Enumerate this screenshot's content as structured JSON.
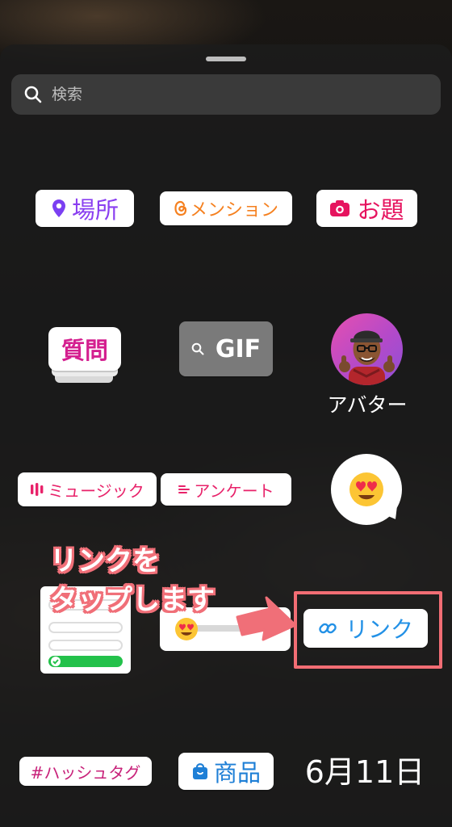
{
  "search": {
    "placeholder": "検索"
  },
  "stickers": {
    "place": "場所",
    "mention": "メンション",
    "question_prompt": "お題",
    "questions": "質問",
    "gif": "GIF",
    "avatar": "アバター",
    "music": "ミュージック",
    "poll": "アンケート",
    "link": "リンク",
    "hashtag": "#ハッシュタグ",
    "shopping": "商品",
    "date": "6月11日"
  },
  "annotation": {
    "line1": "リンクを",
    "line2": "タップします"
  },
  "colors": {
    "highlight": "#f26d74",
    "link_blue": "#2391e6",
    "mention_orange": "#f5801f",
    "place_purple": "#8a3ff0",
    "prompt_pink": "#e6145f"
  }
}
